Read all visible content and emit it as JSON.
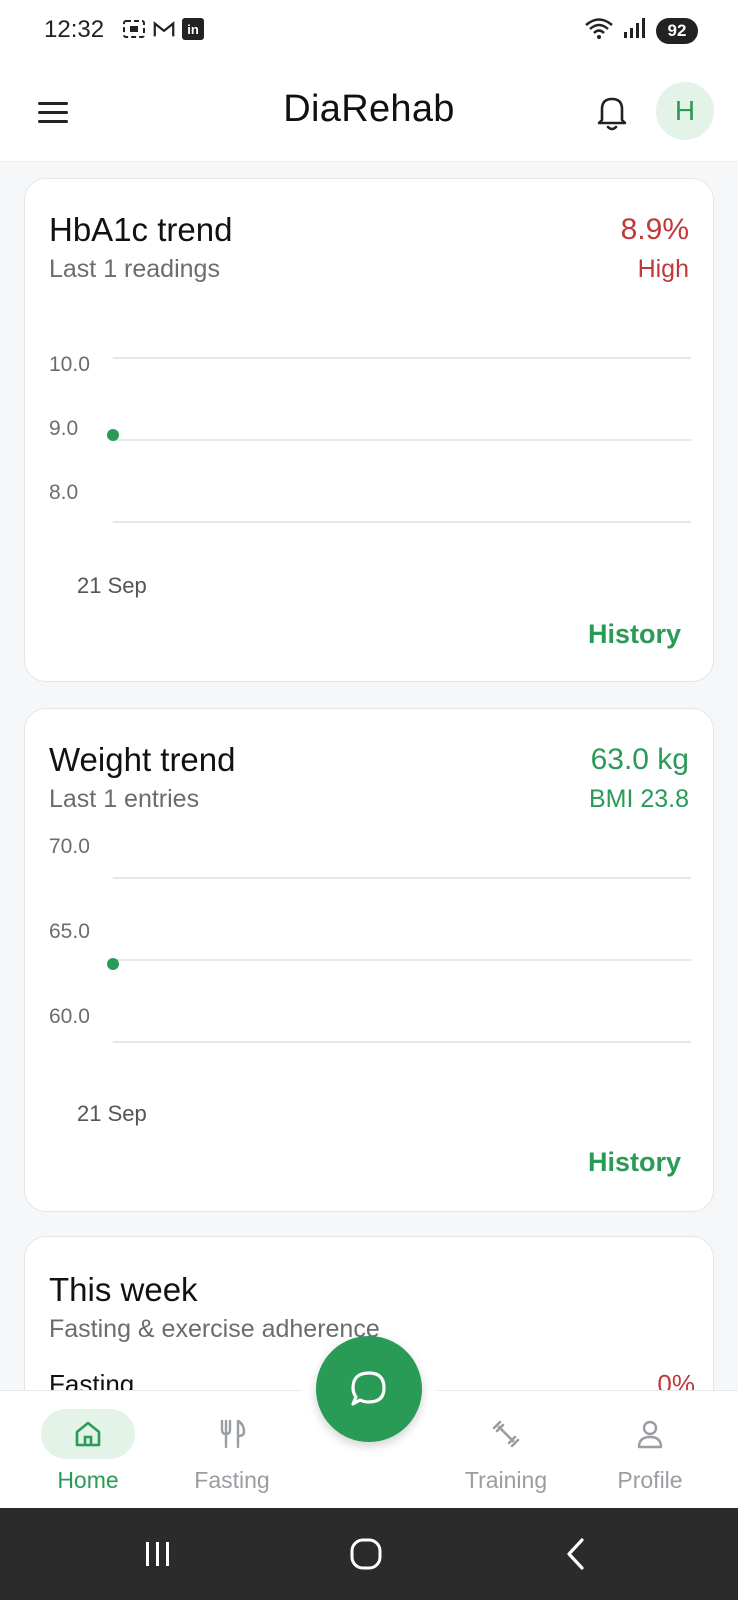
{
  "status_bar": {
    "time": "12:32",
    "icons": [
      "screen-record-icon",
      "gmail-icon",
      "linkedin-icon",
      "wifi-icon",
      "signal-icon"
    ],
    "battery": "92"
  },
  "app_bar": {
    "title": "DiaRehab",
    "avatar_initial": "H"
  },
  "hba1c_card": {
    "title": "HbA1c trend",
    "subtitle": "Last 1 readings",
    "value": "8.9%",
    "status": "High",
    "y_ticks": [
      "10.0",
      "9.0",
      "8.0"
    ],
    "x_label": "21 Sep",
    "history_label": "History"
  },
  "weight_card": {
    "title": "Weight trend",
    "subtitle": "Last 1 entries",
    "value": "63.0 kg",
    "bmi": "BMI 23.8",
    "y_ticks": [
      "70.0",
      "65.0",
      "60.0"
    ],
    "x_label": "21 Sep",
    "history_label": "History"
  },
  "week_card": {
    "title": "This week",
    "subtitle": "Fasting & exercise adherence",
    "row_label": "Fasting",
    "row_value": "0%"
  },
  "bottom_nav": {
    "items": [
      {
        "label": "Home",
        "icon": "home-icon",
        "active": true
      },
      {
        "label": "Fasting",
        "icon": "fork-knife-icon",
        "active": false
      },
      {
        "label": "Training",
        "icon": "dumbbell-icon",
        "active": false
      },
      {
        "label": "Profile",
        "icon": "person-icon",
        "active": false
      }
    ],
    "fab_icon": "chat-icon"
  },
  "colors": {
    "accent": "#2a9a57",
    "alert": "#c0393b",
    "avatar_bg": "#e3f3e8"
  }
}
